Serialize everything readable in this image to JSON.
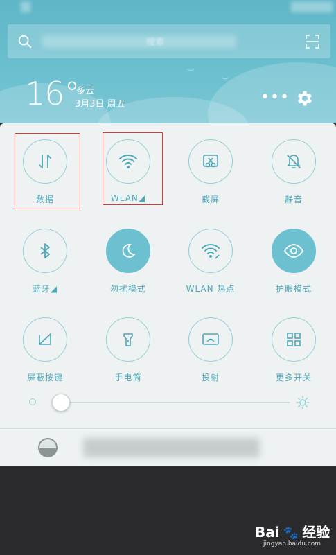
{
  "header": {
    "temperature": "16°",
    "weather": "多云",
    "date": "3月3日 周五",
    "more_glyph": "•••"
  },
  "search": {
    "placeholder_text": "搜索"
  },
  "tiles": [
    {
      "label": "数据",
      "icon": "data-arrows-icon",
      "active": false
    },
    {
      "label": "WLAN◢",
      "icon": "wifi-icon",
      "active": false
    },
    {
      "label": "截屏",
      "icon": "screenshot-scissors-icon",
      "active": false
    },
    {
      "label": "静音",
      "icon": "bell-off-icon",
      "active": false
    },
    {
      "label": "蓝牙◢",
      "icon": "bluetooth-icon",
      "active": false
    },
    {
      "label": "勿扰模式",
      "icon": "moon-icon",
      "active": true
    },
    {
      "label": "WLAN 热点",
      "icon": "hotspot-icon",
      "active": false
    },
    {
      "label": "护眼模式",
      "icon": "eye-icon",
      "active": true
    },
    {
      "label": "屏蔽按键",
      "icon": "block-keys-icon",
      "active": false
    },
    {
      "label": "手电筒",
      "icon": "flashlight-icon",
      "active": false
    },
    {
      "label": "投射",
      "icon": "cast-icon",
      "active": false
    },
    {
      "label": "更多开关",
      "icon": "grid-icon",
      "active": false
    }
  ],
  "brightness": {
    "level": 0.03
  },
  "watermark": {
    "brand": "Bai",
    "brand2": "经验",
    "url": "jingyan.baidu.com"
  },
  "colors": {
    "accent": "#6cc0cf",
    "highlight": "#e0322e",
    "panel": "#eef2f2"
  }
}
